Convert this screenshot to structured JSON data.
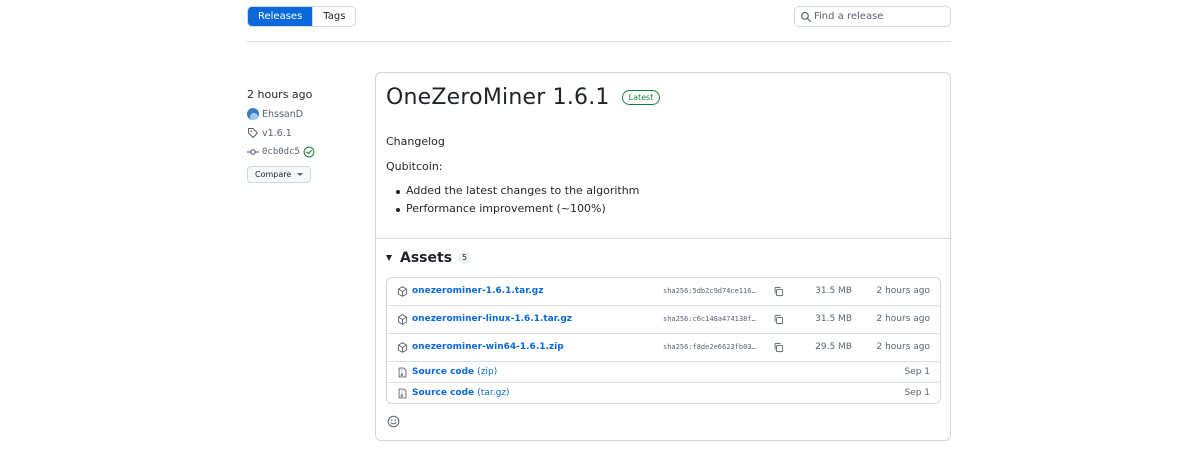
{
  "subnav": {
    "tabs": [
      {
        "label": "Releases",
        "active": true
      },
      {
        "label": "Tags",
        "active": false
      }
    ],
    "search_placeholder": "Find a release"
  },
  "meta": {
    "time": "2 hours ago",
    "author": "EhssanD",
    "tag": "v1.6.1",
    "commit": "0cb0dc5",
    "compare_label": "Compare"
  },
  "release": {
    "title": "OneZeroMiner 1.6.1",
    "badge": "Latest",
    "changelog_heading": "Changelog",
    "section": "Qubitcoin:",
    "bullets": [
      "Added the latest changes to the algorithm",
      "Performance improvement (~100%)"
    ]
  },
  "assets": {
    "title": "Assets",
    "count": "5",
    "files": [
      {
        "name": "onezerominer-1.6.1.tar.gz",
        "sha": "sha256:5db2c9d74ce116…",
        "size": "31.5 MB",
        "date": "2 hours ago"
      },
      {
        "name": "onezerominer-linux-1.6.1.tar.gz",
        "sha": "sha256:c6c148a474138f…",
        "size": "31.5 MB",
        "date": "2 hours ago"
      },
      {
        "name": "onezerominer-win64-1.6.1.zip",
        "sha": "sha256:f8de2e6623fb03…",
        "size": "29.5 MB",
        "date": "2 hours ago"
      }
    ],
    "source": [
      {
        "name": "Source code",
        "ext": "(zip)",
        "date": "Sep 1"
      },
      {
        "name": "Source code",
        "ext": "(tar.gz)",
        "date": "Sep 1"
      }
    ]
  },
  "colors": {
    "accent": "#0969da",
    "success": "#1a7f37",
    "border": "#d0d7de",
    "muted": "#59636e"
  }
}
